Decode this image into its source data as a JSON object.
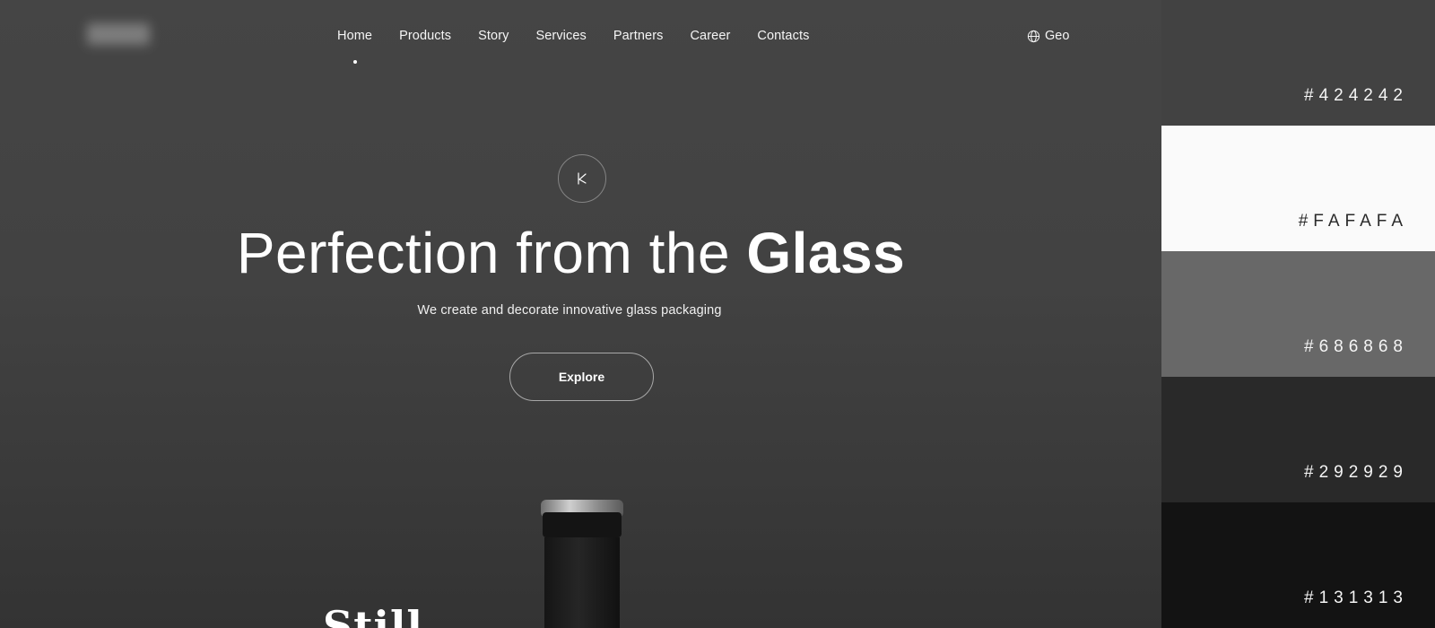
{
  "nav": {
    "items": [
      {
        "label": "Home",
        "active": true
      },
      {
        "label": "Products"
      },
      {
        "label": "Story"
      },
      {
        "label": "Services"
      },
      {
        "label": "Partners"
      },
      {
        "label": "Career"
      },
      {
        "label": "Contacts"
      }
    ],
    "geo_label": "Geo",
    "geo_icon": "globe-icon"
  },
  "hero": {
    "badge_icon": "k-monogram-icon",
    "headline_light": "Perfection from the",
    "headline_bold": "Glass",
    "subtitle": "We create and decorate innovative glass packaging",
    "cta_label": "Explore",
    "partial_text": "Still"
  },
  "palette": {
    "swatches": [
      {
        "label": "#424242",
        "color": "#424242",
        "text_color": "#f5f5f5"
      },
      {
        "label": "#FAFAFA",
        "color": "#FAFAFA",
        "text_color": "#2a2a2a"
      },
      {
        "label": "#686868",
        "color": "#686868",
        "text_color": "#f5f5f5"
      },
      {
        "label": "#292929",
        "color": "#292929",
        "text_color": "#f5f5f5"
      },
      {
        "label": "#131313",
        "color": "#131313",
        "text_color": "#f5f5f5"
      }
    ]
  }
}
